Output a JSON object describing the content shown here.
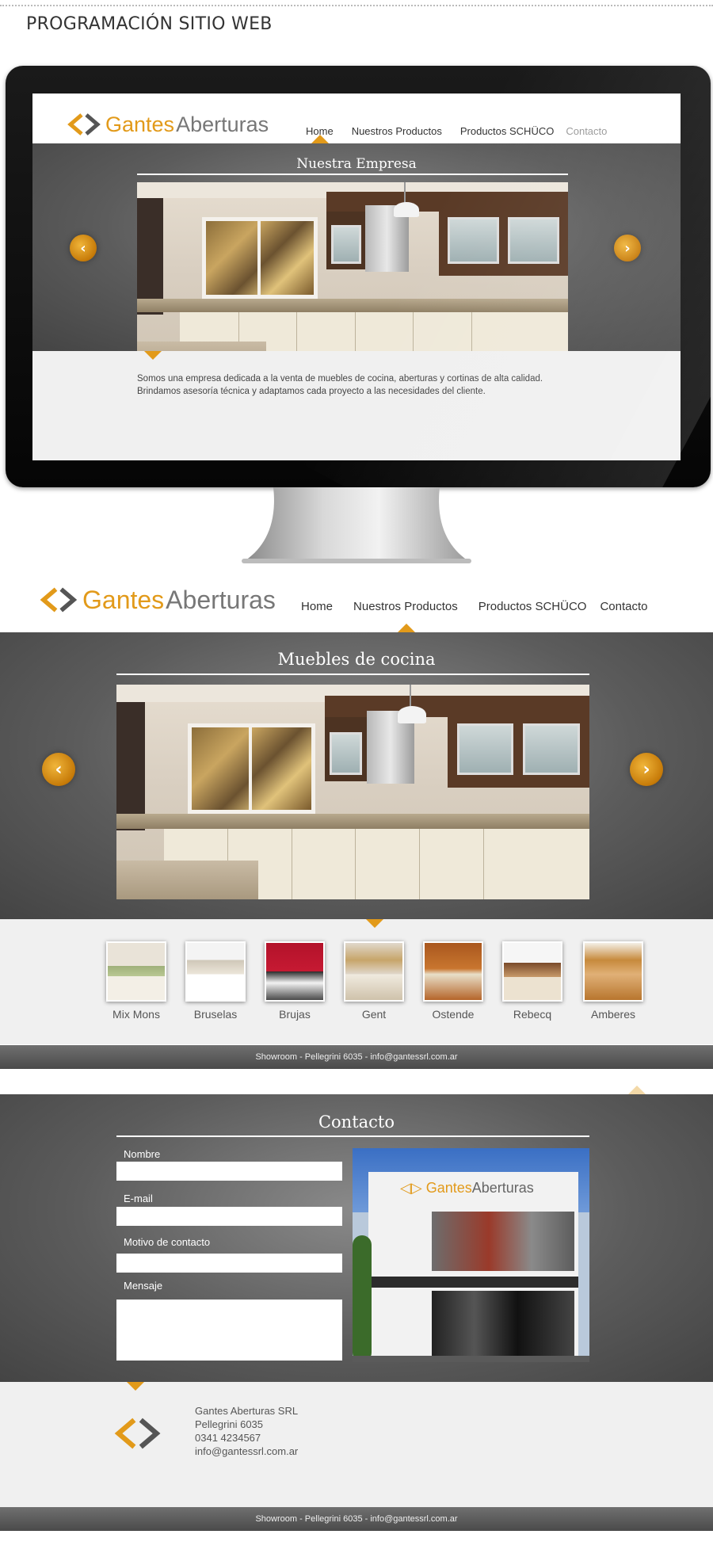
{
  "page_title": "PROGRAMACIÓN SITIO WEB",
  "brand": {
    "name_part1": "Gantes",
    "name_part2": "Aberturas",
    "accent_color": "#e29a1a"
  },
  "nav": [
    {
      "label": "Home"
    },
    {
      "label": "Nuestros Productos"
    },
    {
      "label": "Productos SCHÜCO"
    },
    {
      "label": "Contacto"
    }
  ],
  "monitor_screen": {
    "section_title": "Nuestra Empresa",
    "description": "Somos una empresa dedicada a la venta de muebles de cocina, aberturas y cortinas de alta calidad. Brindamos asesoría técnica y adaptamos cada proyecto a las necesidades del cliente."
  },
  "products_page": {
    "section_title": "Muebles de cocina",
    "thumbnails": [
      {
        "label": "Mix Mons"
      },
      {
        "label": "Bruselas"
      },
      {
        "label": "Brujas"
      },
      {
        "label": "Gent"
      },
      {
        "label": "Ostende"
      },
      {
        "label": "Rebecq"
      },
      {
        "label": "Amberes"
      }
    ],
    "footer": "Showroom  -  Pellegrini 6035  -  info@gantessrl.com.ar"
  },
  "contact_page": {
    "section_title": "Contacto",
    "fields": [
      {
        "label": "Nombre"
      },
      {
        "label": "E-mail"
      },
      {
        "label": "Motivo de contacto"
      },
      {
        "label": "Mensaje"
      }
    ],
    "address": {
      "company": "Gantes Aberturas SRL",
      "street": "Pellegrini 6035",
      "phone": "0341 4234567",
      "email": "info@gantessrl.com.ar"
    },
    "footer": "Showroom  -  Pellegrini 6035  -  info@gantessrl.com.ar"
  }
}
